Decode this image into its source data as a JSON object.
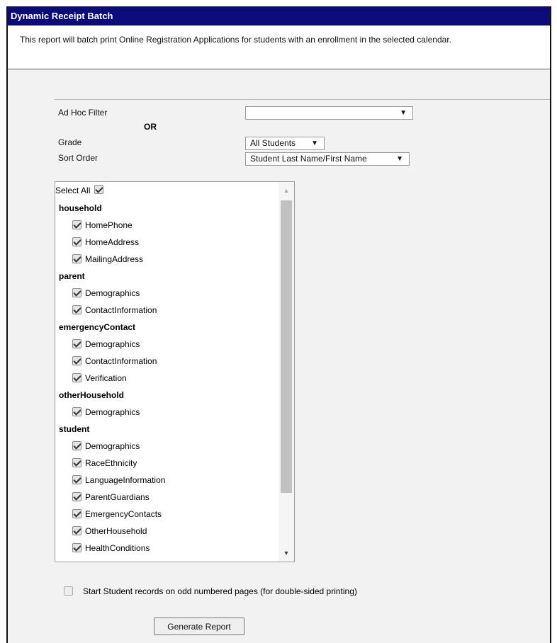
{
  "window": {
    "title": "Dynamic Receipt Batch",
    "description": "This report will batch print Online Registration Applications for students with an enrollment in the selected calendar."
  },
  "filters": {
    "ad_hoc_label": "Ad Hoc Filter",
    "ad_hoc_value": "",
    "or_label": "OR",
    "grade_label": "Grade",
    "grade_value": "All Students",
    "sort_label": "Sort Order",
    "sort_value": "Student Last Name/First Name",
    "dropdown_arrow": "▼"
  },
  "checklist": {
    "select_all_label": "Select All",
    "groups": [
      {
        "name": "household",
        "items": [
          "HomePhone",
          "HomeAddress",
          "MailingAddress"
        ]
      },
      {
        "name": "parent",
        "items": [
          "Demographics",
          "ContactInformation"
        ]
      },
      {
        "name": "emergencyContact",
        "items": [
          "Demographics",
          "ContactInformation",
          "Verification"
        ]
      },
      {
        "name": "otherHousehold",
        "items": [
          "Demographics"
        ]
      },
      {
        "name": "student",
        "items": [
          "Demographics",
          "RaceEthnicity",
          "LanguageInformation",
          "ParentGuardians",
          "EmergencyContacts",
          "OtherHousehold",
          "HealthConditions"
        ]
      }
    ],
    "scroll_up_glyph": "▲",
    "scroll_down_glyph": "▼"
  },
  "options": {
    "odd_pages_label": "Start Student records on odd numbered pages (for double-sided printing)",
    "odd_pages_checked": false
  },
  "actions": {
    "generate_label": "Generate Report"
  },
  "colors": {
    "titlebar": "#0b0c7a",
    "panel_bg": "#f2f2f2"
  }
}
